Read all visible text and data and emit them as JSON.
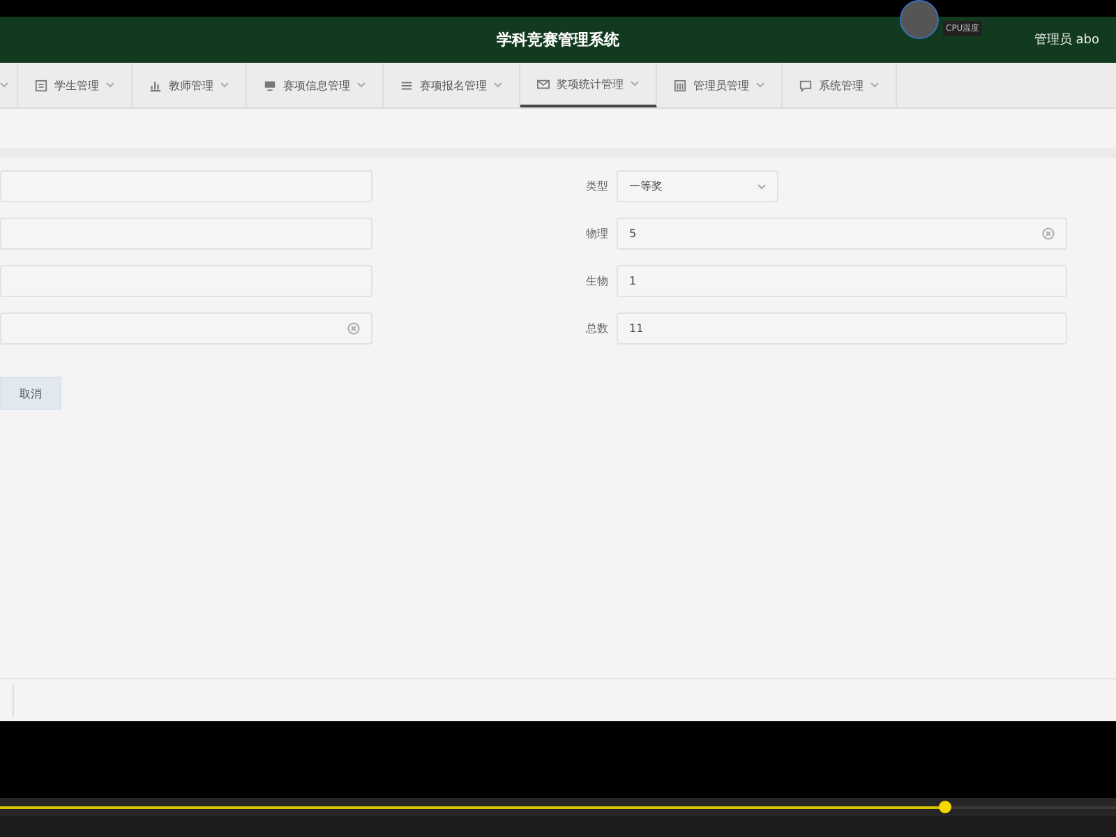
{
  "header": {
    "title": "学科竞赛管理系统",
    "user": "管理员 abo"
  },
  "overlay": {
    "label": "CPU温度"
  },
  "nav": [
    {
      "label": "学生管理",
      "selected": false
    },
    {
      "label": "教师管理",
      "selected": false
    },
    {
      "label": "赛项信息管理",
      "selected": false
    },
    {
      "label": "赛项报名管理",
      "selected": false
    },
    {
      "label": "奖项统计管理",
      "selected": true
    },
    {
      "label": "管理员管理",
      "selected": false
    },
    {
      "label": "系统管理",
      "selected": false
    }
  ],
  "form": {
    "left_fields": [
      {
        "clearable": false
      },
      {
        "clearable": false
      },
      {
        "clearable": false
      },
      {
        "clearable": true
      }
    ],
    "buttons": [
      {
        "label": "取消"
      }
    ],
    "right_fields": [
      {
        "label": "类型",
        "kind": "select",
        "value": "一等奖"
      },
      {
        "label": "物理",
        "kind": "input",
        "value": "5",
        "clearable": true
      },
      {
        "label": "生物",
        "kind": "input",
        "value": "1",
        "clearable": false
      },
      {
        "label": "总数",
        "kind": "input",
        "value": "11",
        "clearable": false
      }
    ]
  },
  "player": {
    "level": 0.846
  }
}
